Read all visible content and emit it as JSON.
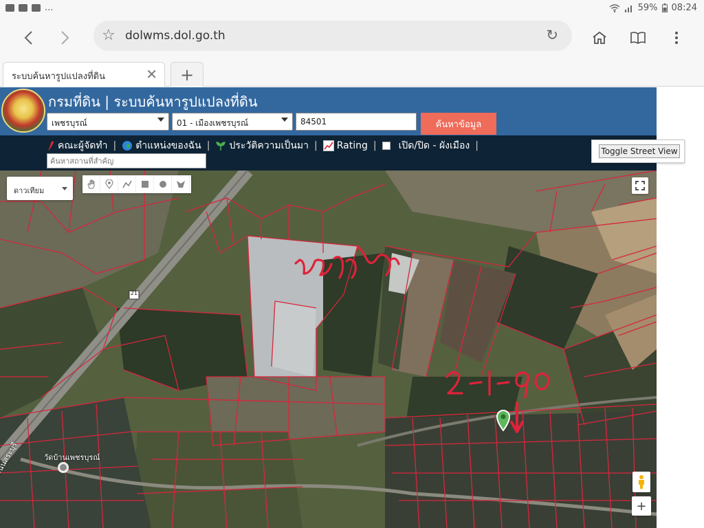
{
  "status_bar": {
    "notification_more": "...",
    "battery": "59%",
    "time": "08:24"
  },
  "browser": {
    "url": "dolwms.dol.go.th",
    "tab_title": "ระบบค้นหารูปแปลงที่ดิน",
    "new_tab_symbol": "+",
    "tab_close_symbol": "✕"
  },
  "header": {
    "title": "กรมที่ดิน | ระบบค้นหารูปแปลงที่ดิน",
    "province_value": "เพชรบุรณ์",
    "district_value": "01 - เมืองเพชรบุรณ์",
    "parcel_number": "84501",
    "search_button": "ค้นหาข้อมูล"
  },
  "menu": {
    "items": [
      {
        "icon": "red-pepper-icon",
        "label": "คณะผู้จัดทำ"
      },
      {
        "icon": "globe-icon",
        "label": "ตำแหน่งของฉัน"
      },
      {
        "icon": "sprout-icon",
        "label": "ประวัติความเป็นมา"
      },
      {
        "icon": "chart-icon",
        "label": "Rating"
      },
      {
        "icon": "checkbox",
        "label": "เปิด/ปิด - ผังเมือง"
      }
    ],
    "place_search_placeholder": "ค้นหาสถานที่สำคัญ"
  },
  "street_view_button": "Toggle Street View",
  "map": {
    "layer_select": "ดาวเทียม",
    "landmark_label": "วัดบ้านเพชรบุรณ์",
    "road_label": "ถนนสระบุรี",
    "route_shield": "21",
    "zoom_in": "+",
    "annotations": {
      "factory_text": "บุหรี่สด",
      "area_text": "2-1-90"
    },
    "colors": {
      "parcel_line": "#d7263d",
      "annotation_ink": "#e0223a",
      "header_bg": "#33689f",
      "menu_bg": "#0e2335",
      "search_button_bg": "#ef6b5a"
    }
  }
}
